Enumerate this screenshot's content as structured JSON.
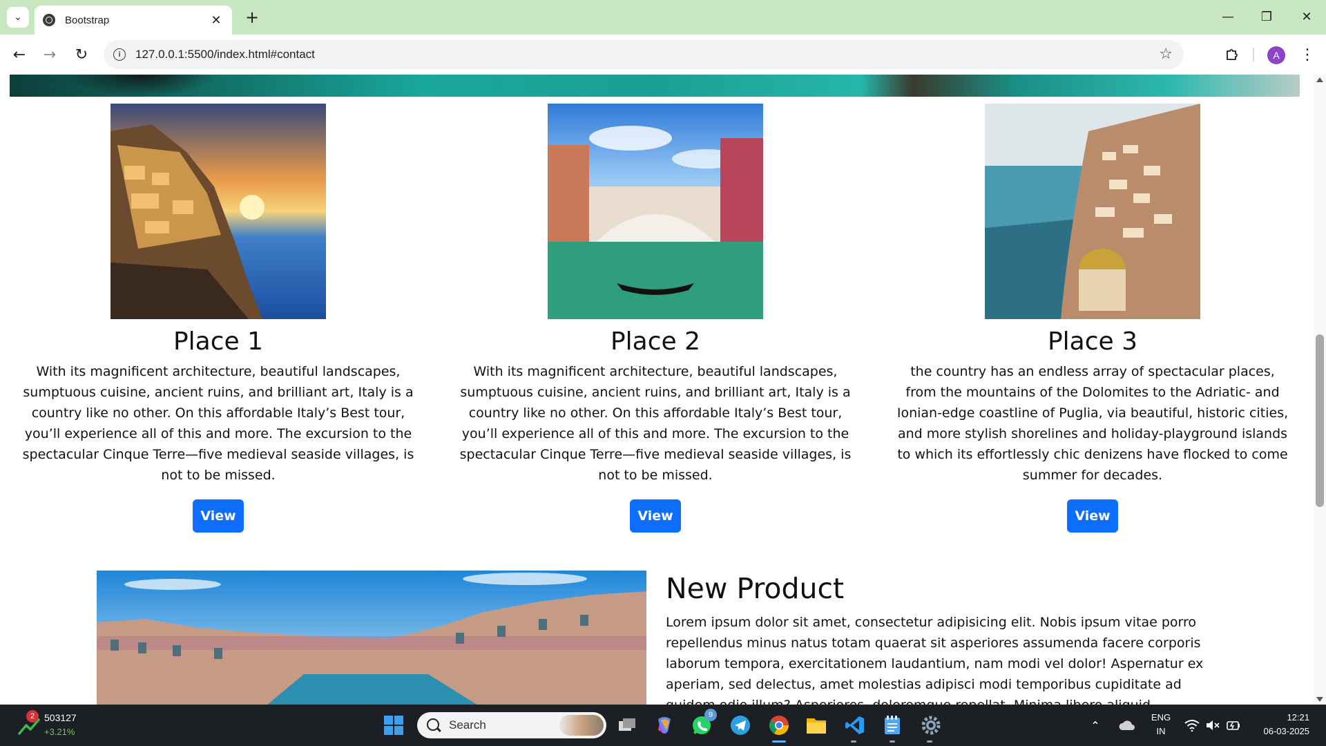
{
  "browser": {
    "tab_title": "Bootstrap",
    "tab_close": "✕",
    "new_tab": "+",
    "url": "127.0.0.1:5500/index.html#contact",
    "window_controls": {
      "minimize": "—",
      "restore": "❐",
      "close": "✕"
    },
    "profile_initial": "A"
  },
  "cards": [
    {
      "title": "Place 1",
      "text": "With its magnificent architecture, beautiful landscapes, sumptuous cuisine, ancient ruins, and brilliant art, Italy is a country like no other. On this affordable Italy’s Best tour, you’ll experience all of this and more. The excursion to the spectacular Cinque Terre—five medieval seaside villages, is not to be missed.",
      "button": "View"
    },
    {
      "title": "Place 2",
      "text": "With its magnificent architecture, beautiful landscapes, sumptuous cuisine, ancient ruins, and brilliant art, Italy is a country like no other. On this affordable Italy’s Best tour, you’ll experience all of this and more. The excursion to the spectacular Cinque Terre—five medieval seaside villages, is not to be missed.",
      "button": "View"
    },
    {
      "title": "Place 3",
      "text": "the country has an endless array of spectacular places, from the mountains of the Dolomites to the Adriatic- and Ionian-edge coastline of Puglia, via beautiful, historic cities, and more stylish shorelines and holiday-playground islands to which its effortlessly chic denizens have flocked to come summer for decades.",
      "button": "View"
    }
  ],
  "product": {
    "title": "New Product",
    "text": "Lorem ipsum dolor sit amet, consectetur adipisicing elit. Nobis ipsum vitae porro repellendus minus natus totam quaerat sit asperiores assumenda facere corporis laborum tempora, exercitationem laudantium, nam modi vel dolor! Aspernatur ex aperiam, sed delectus, amet molestias adipisci modi temporibus cupiditate ad quidem odio illum? Asperiores, doloremque repellat. Minima libero aliquid cupiditate."
  },
  "taskbar": {
    "stock_badge": "2",
    "stock_value": "503127",
    "stock_change": "+3.21%",
    "search_placeholder": "Search",
    "whatsapp_badge": "9",
    "lang_line1": "ENG",
    "lang_line2": "IN",
    "time": "12:21",
    "date": "06-03-2025"
  },
  "colors": {
    "chrome_frame": "#c8e6c0",
    "primary_button": "#0d6efd",
    "taskbar": "#1c1f24"
  }
}
